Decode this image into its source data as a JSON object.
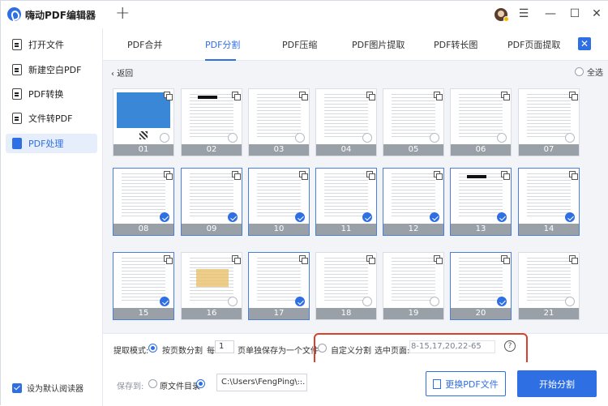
{
  "app": {
    "title": "嗨动PDF编辑器"
  },
  "sidebar": {
    "items": [
      {
        "label": "打开文件"
      },
      {
        "label": "新建空白PDF"
      },
      {
        "label": "PDF转换"
      },
      {
        "label": "文件转PDF"
      },
      {
        "label": "PDF处理",
        "active": true
      }
    ],
    "default_reader_label": "设为默认阅读器"
  },
  "tabs": [
    {
      "label": "PDF合并"
    },
    {
      "label": "PDF分割",
      "active": true
    },
    {
      "label": "PDF压缩"
    },
    {
      "label": "PDF图片提取"
    },
    {
      "label": "PDF转长图"
    },
    {
      "label": "PDF页面提取"
    }
  ],
  "toolbar": {
    "back_label": "返回",
    "select_all_label": "全选"
  },
  "pages": [
    {
      "num": "01",
      "selected": false
    },
    {
      "num": "02",
      "selected": false
    },
    {
      "num": "03",
      "selected": false
    },
    {
      "num": "04",
      "selected": false
    },
    {
      "num": "05",
      "selected": false
    },
    {
      "num": "06",
      "selected": false
    },
    {
      "num": "07",
      "selected": false
    },
    {
      "num": "08",
      "selected": true
    },
    {
      "num": "09",
      "selected": true
    },
    {
      "num": "10",
      "selected": true
    },
    {
      "num": "11",
      "selected": true
    },
    {
      "num": "12",
      "selected": true
    },
    {
      "num": "13",
      "selected": true
    },
    {
      "num": "14",
      "selected": true
    },
    {
      "num": "15",
      "selected": true
    },
    {
      "num": "16",
      "selected": false
    },
    {
      "num": "17",
      "selected": true
    },
    {
      "num": "18",
      "selected": false
    },
    {
      "num": "19",
      "selected": false
    },
    {
      "num": "20",
      "selected": true
    },
    {
      "num": "21",
      "selected": false
    }
  ],
  "mode": {
    "label": "提取模式:",
    "by_pages_label": "按页数分割",
    "every_label": "每",
    "every_value": "1",
    "pages_per_file_label": "页单独保存为一个文件",
    "custom_label": "自定义分割",
    "selected_pages_label": "选中页面:",
    "selected_pages_value": "8-15,17,20,22-65",
    "help_icon": "?"
  },
  "save": {
    "label": "保存到:",
    "source_dir_label": "原文件目录",
    "path_value": "C:\\Users\\FengPing\\...",
    "browse_dots": "···",
    "change_button": "更换PDF文件",
    "start_button": "开始分割"
  },
  "window": {
    "plus": "+",
    "menu": "☰",
    "minimize": "—",
    "maximize": "☐",
    "close": "✕",
    "tab_close": "✕"
  }
}
